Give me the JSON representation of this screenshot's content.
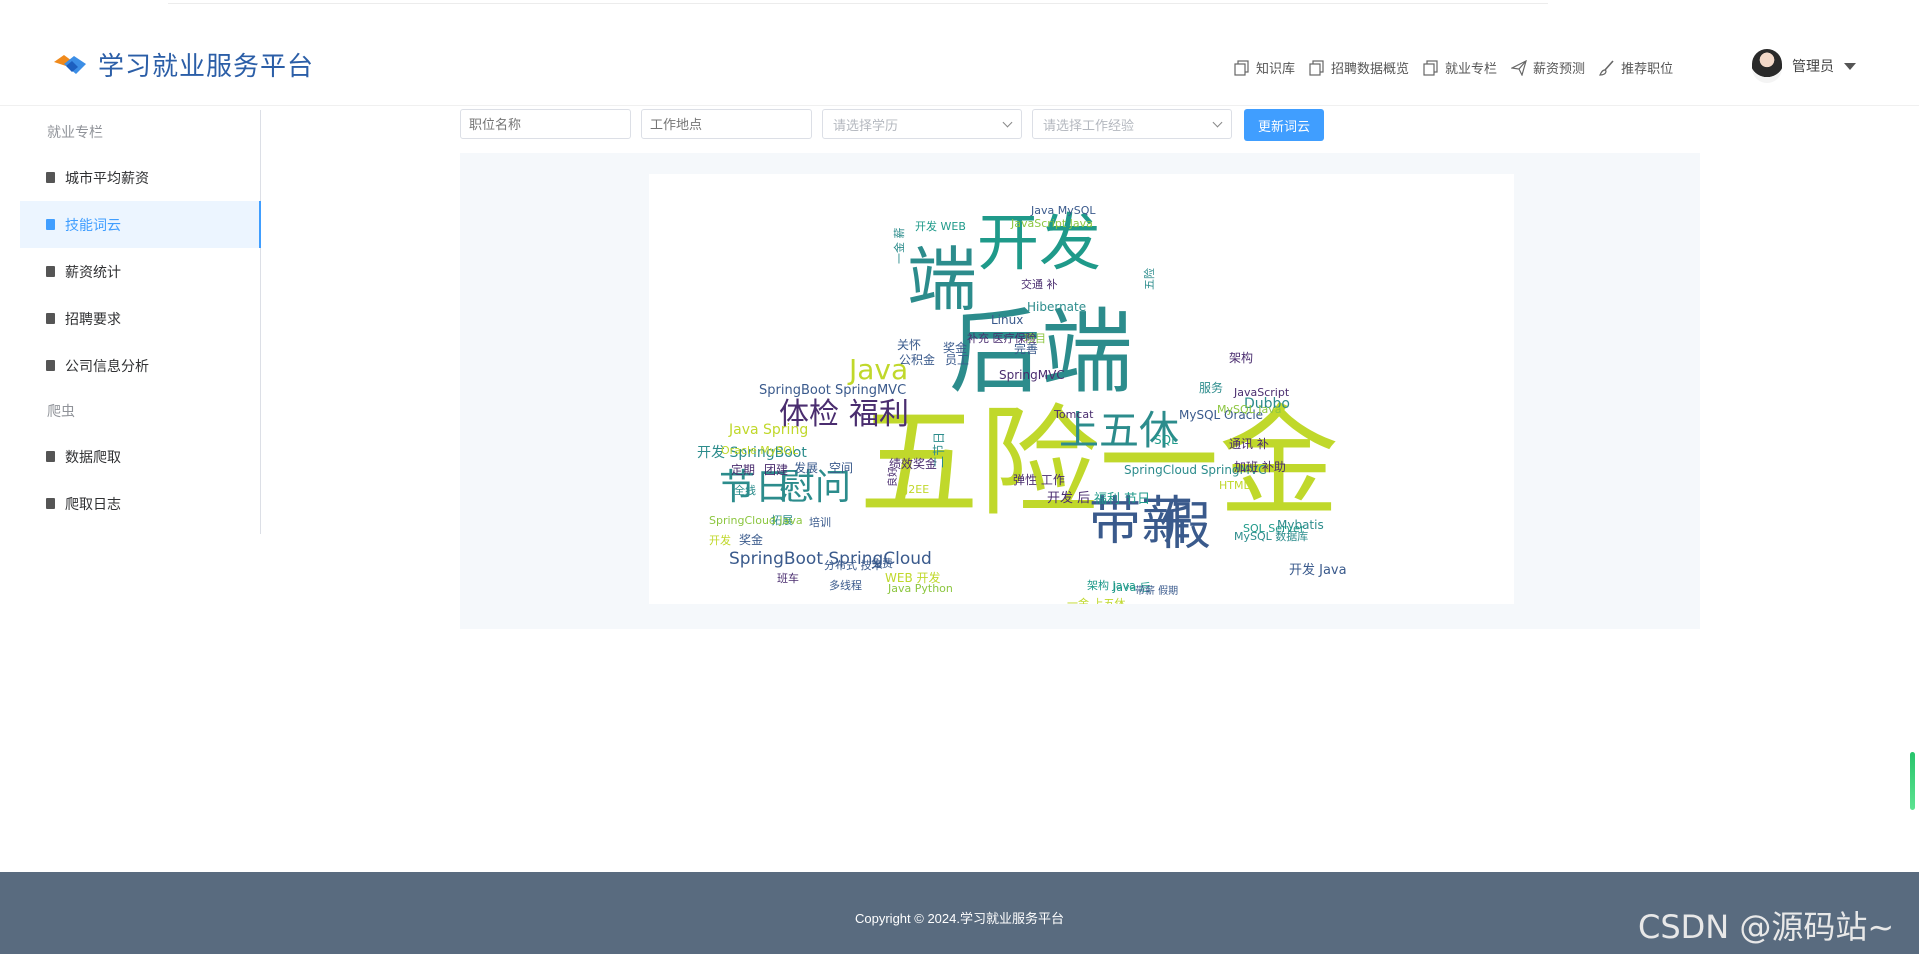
{
  "brand": {
    "title": "学习就业服务平台",
    "accent": "#409eff",
    "title_color": "#2b5ea7"
  },
  "nav": [
    {
      "label": "知识库",
      "icon": "copy-icon"
    },
    {
      "label": "招聘数据概览",
      "icon": "copy-icon"
    },
    {
      "label": "就业专栏",
      "icon": "copy-icon"
    },
    {
      "label": "薪资预测",
      "icon": "paper-plane-icon"
    },
    {
      "label": "推荐职位",
      "icon": "brush-icon"
    }
  ],
  "user": {
    "name": "管理员"
  },
  "sidebar": {
    "group1": "就业专栏",
    "items1": [
      "城市平均薪资",
      "技能词云",
      "薪资统计",
      "招聘要求",
      "公司信息分析"
    ],
    "group2": "爬虫",
    "items2": [
      "数据爬取",
      "爬取日志"
    ],
    "active": "技能词云"
  },
  "filters": {
    "job_placeholder": "职位名称",
    "location_placeholder": "工作地点",
    "education_placeholder": "请选择学历",
    "experience_placeholder": "请选择工作经验",
    "refresh_label": "更新词云"
  },
  "wordcloud": {
    "palette": [
      "#c0d82b",
      "#2c8c8c",
      "#3a5a8c",
      "#4a2d6f",
      "#1f9a8a",
      "#8cc63f"
    ],
    "words": [
      "五险一金",
      "后端",
      "端",
      "开发",
      "带薪",
      "假",
      "上五休",
      "节日",
      "慰问",
      "体检",
      "福利",
      "Java",
      "SpringBoot SpringCloud",
      "Java Spring",
      "开发 SpringBoot",
      "SpringBoot SpringMVC",
      "SpringCloud SpringMVC",
      "定期",
      "团建",
      "发展",
      "空间",
      "全线",
      "开发",
      "奖金",
      "拓展",
      "培训",
      "分布式 技术",
      "免费",
      "班车",
      "多线程",
      "公积金",
      "员工",
      "关怀",
      "绩效奖金",
      "J2EE",
      "Linux",
      "项目",
      "奖金",
      "Tomcat",
      "Hibernate",
      "完善",
      "交通 补",
      "SpringMVC",
      "服务",
      "架构",
      "Dubbo",
      "SQL",
      "JavaScript",
      "MySQL Oracle",
      "通讯 补",
      "HTML",
      "加班 补助",
      "Mybatis",
      "开发 Java",
      "SQL Server",
      "Redis",
      "微 服务",
      "Oracle",
      "开发 后",
      "福利 节日",
      "弹性 工作",
      "WEB 开发",
      "Java Python",
      "Java MySQL",
      "JavaScript Java",
      "开发 WEB",
      "补充 医疗保险",
      "架构 Java",
      "一金 上五休",
      "Java 后",
      "带薪 假期",
      "一金 薪",
      "五险",
      "良好",
      "二节日",
      "MySQL Java",
      "Oracle MySQL",
      "SpringCloud Java",
      "MySQL 数据库",
      "绩效奖金 带薪",
      "数据库",
      "Python",
      "SSH"
    ]
  }
}
